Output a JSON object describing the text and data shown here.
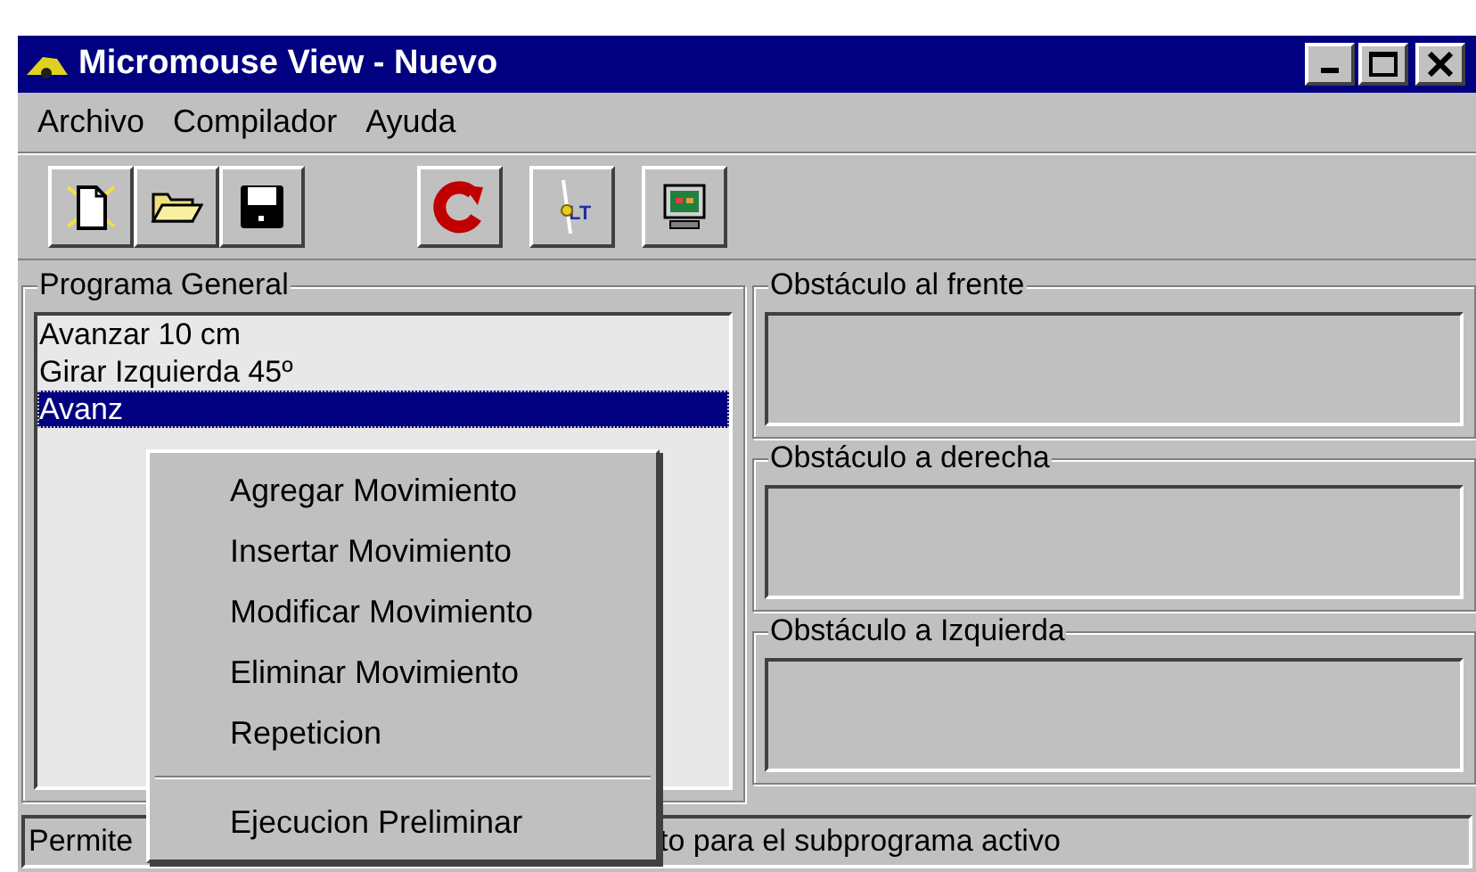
{
  "window": {
    "title": "Micromouse View - Nuevo"
  },
  "menu": [
    "Archivo",
    "Compilador",
    "Ayuda"
  ],
  "toolbar": [
    [
      {
        "kind": "new"
      },
      {
        "kind": "open"
      },
      {
        "kind": "save"
      }
    ],
    [
      {
        "kind": "refresh"
      }
    ],
    [
      {
        "kind": "lt",
        "label": "LT"
      }
    ],
    [
      {
        "kind": "monitor"
      }
    ]
  ],
  "program": {
    "title": "Programa General",
    "items": [
      {
        "text": "Avanzar 10 cm",
        "selected": false
      },
      {
        "text": "Girar Izquierda 45º",
        "selected": false
      },
      {
        "text": "Avanz",
        "selected": true
      }
    ]
  },
  "sensors": [
    {
      "title": "Obstáculo al frente"
    },
    {
      "title": "Obstáculo a derecha"
    },
    {
      "title": "Obstáculo a Izquierda"
    }
  ],
  "status_bar": {
    "left": "Permite",
    "right": "to para el subprograma activo"
  },
  "context_menu": [
    {
      "kind": "item",
      "label": "Agregar Movimiento"
    },
    {
      "kind": "item",
      "label": "Insertar Movimiento"
    },
    {
      "kind": "item",
      "label": "Modificar Movimiento"
    },
    {
      "kind": "item",
      "label": "Eliminar Movimiento"
    },
    {
      "kind": "item",
      "label": "Repeticion"
    },
    {
      "kind": "separator"
    },
    {
      "kind": "item",
      "label": "Ejecucion Preliminar"
    }
  ]
}
